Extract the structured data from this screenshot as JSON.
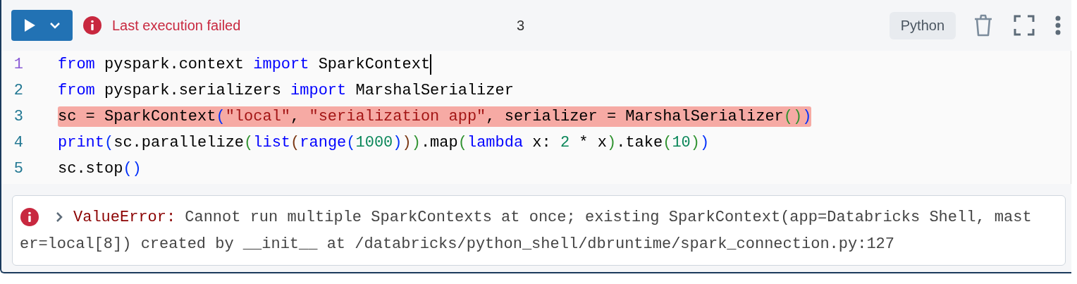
{
  "toolbar": {
    "status": "Last execution failed",
    "cell_number": "3",
    "language": "Python"
  },
  "code": {
    "lines": [
      {
        "number": "1",
        "active": true,
        "highlighted": false,
        "tokens": [
          {
            "text": "from",
            "kind": "kw"
          },
          {
            "text": " pyspark.context ",
            "kind": "plain"
          },
          {
            "text": "import",
            "kind": "kw"
          },
          {
            "text": " SparkContext",
            "kind": "plain"
          }
        ]
      },
      {
        "number": "2",
        "active": false,
        "highlighted": false,
        "tokens": [
          {
            "text": "from",
            "kind": "kw"
          },
          {
            "text": " pyspark.serializers ",
            "kind": "plain"
          },
          {
            "text": "import",
            "kind": "kw"
          },
          {
            "text": " MarshalSerializer",
            "kind": "plain"
          }
        ]
      },
      {
        "number": "3",
        "active": false,
        "highlighted": true,
        "tokens": [
          {
            "text": "sc = SparkContext",
            "kind": "plain"
          },
          {
            "text": "(",
            "kind": "p1"
          },
          {
            "text": "\"local\"",
            "kind": "str"
          },
          {
            "text": ", ",
            "kind": "plain"
          },
          {
            "text": "\"serialization app\"",
            "kind": "str"
          },
          {
            "text": ", serializer = MarshalSerializer",
            "kind": "plain"
          },
          {
            "text": "()",
            "kind": "p2"
          },
          {
            "text": ")",
            "kind": "p1"
          }
        ]
      },
      {
        "number": "4",
        "active": false,
        "highlighted": false,
        "tokens": [
          {
            "text": "print",
            "kind": "kw"
          },
          {
            "text": "(",
            "kind": "p1"
          },
          {
            "text": "sc.parallelize",
            "kind": "plain"
          },
          {
            "text": "(",
            "kind": "p2"
          },
          {
            "text": "list",
            "kind": "kw"
          },
          {
            "text": "(",
            "kind": "p3"
          },
          {
            "text": "range",
            "kind": "kw"
          },
          {
            "text": "(",
            "kind": "p1"
          },
          {
            "text": "1000",
            "kind": "num"
          },
          {
            "text": ")",
            "kind": "p1"
          },
          {
            "text": ")",
            "kind": "p3"
          },
          {
            "text": ")",
            "kind": "p2"
          },
          {
            "text": ".map",
            "kind": "plain"
          },
          {
            "text": "(",
            "kind": "p2"
          },
          {
            "text": "lambda",
            "kind": "kw"
          },
          {
            "text": " x: ",
            "kind": "plain"
          },
          {
            "text": "2",
            "kind": "num"
          },
          {
            "text": " * x",
            "kind": "plain"
          },
          {
            "text": ")",
            "kind": "p2"
          },
          {
            "text": ".take",
            "kind": "plain"
          },
          {
            "text": "(",
            "kind": "p2"
          },
          {
            "text": "10",
            "kind": "num"
          },
          {
            "text": ")",
            "kind": "p2"
          },
          {
            "text": ")",
            "kind": "p1"
          }
        ]
      },
      {
        "number": "5",
        "active": false,
        "highlighted": false,
        "tokens": [
          {
            "text": "sc.stop",
            "kind": "plain"
          },
          {
            "text": "()",
            "kind": "p1"
          }
        ]
      }
    ]
  },
  "error": {
    "type": "ValueError:",
    "lines": [
      "Cannot run multiple SparkContexts at once; existing SparkContext(app=Databricks Shell, mast",
      "er=local[8]) created by __init__ at /databricks/python_shell/dbruntime/spark_connection.py:127"
    ]
  }
}
